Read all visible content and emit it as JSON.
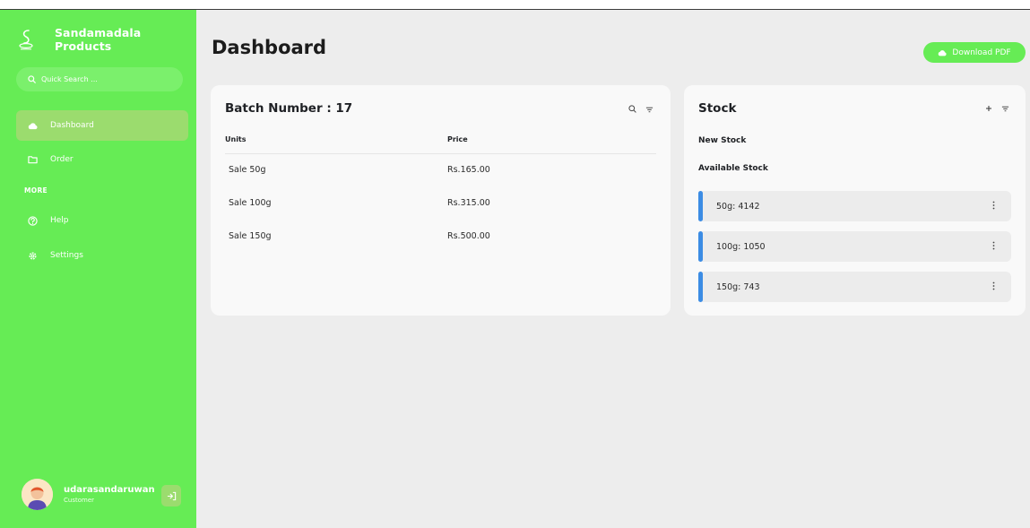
{
  "app": {
    "brand_name": "Sandamadala Products"
  },
  "sidebar": {
    "search_placeholder": "Quick Search ...",
    "items": [
      {
        "label": "Dashboard",
        "icon": "cloud-icon",
        "active": true
      },
      {
        "label": "Order",
        "icon": "folder-icon",
        "active": false
      }
    ],
    "section_label": "MORE",
    "more_items": [
      {
        "label": "Help",
        "icon": "help-icon"
      },
      {
        "label": "Settings",
        "icon": "settings-icon"
      }
    ],
    "user": {
      "name": "udarasandaruwan",
      "role": "Customer"
    }
  },
  "header": {
    "title": "Dashboard",
    "download_label": "Download PDF"
  },
  "batch": {
    "title": "Batch Number : 17",
    "columns": [
      "Units",
      "Price"
    ],
    "rows": [
      {
        "unit": "Sale 50g",
        "price": "Rs.165.00"
      },
      {
        "unit": "Sale 100g",
        "price": "Rs.315.00"
      },
      {
        "unit": "Sale 150g",
        "price": "Rs.500.00"
      }
    ]
  },
  "stock": {
    "title": "Stock",
    "new_stock_label": "New Stock",
    "available_label": "Available Stock",
    "items": [
      {
        "label": "50g: 4142"
      },
      {
        "label": "100g: 1050"
      },
      {
        "label": "150g: 743"
      }
    ]
  },
  "colors": {
    "brand_green": "#66ec55",
    "accent_blue": "#3c8ce4",
    "background": "#ededed"
  }
}
